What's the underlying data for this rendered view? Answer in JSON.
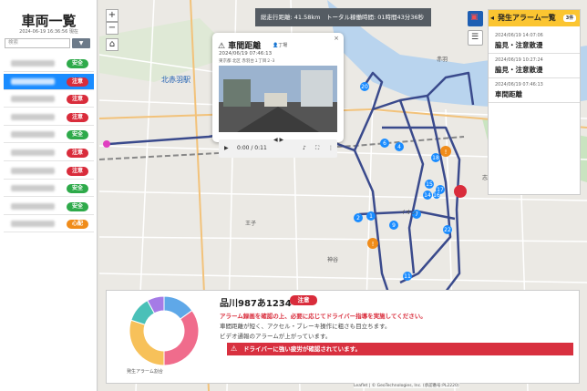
{
  "sidebar": {
    "title": "車両一覧",
    "updated": "2024-06-19 16:36:56 現在",
    "search_placeholder": "検索",
    "filter_icon": "filter-icon",
    "vehicles": [
      {
        "status": "安全",
        "color": "green",
        "selected": false
      },
      {
        "status": "注意",
        "color": "red",
        "selected": true
      },
      {
        "status": "注意",
        "color": "red",
        "selected": false
      },
      {
        "status": "注意",
        "color": "red",
        "selected": false
      },
      {
        "status": "安全",
        "color": "green",
        "selected": false
      },
      {
        "status": "注意",
        "color": "red",
        "selected": false
      },
      {
        "status": "注意",
        "color": "red",
        "selected": false
      },
      {
        "status": "安全",
        "color": "green",
        "selected": false
      },
      {
        "status": "安全",
        "color": "green",
        "selected": false
      },
      {
        "status": "心配",
        "color": "orange",
        "selected": false
      }
    ]
  },
  "map": {
    "zoom_in": "+",
    "zoom_out": "−",
    "labels": [
      "北赤羽駅",
      "志茂",
      "赤羽",
      "神谷",
      "王子",
      "イオン"
    ],
    "stats": "総走行距離: 41.58km　トータル稼働時間: 01時間43分36秒",
    "attribution": "Leaflet | © GeoTechnologies, Inc. (承認番号:PL2220)"
  },
  "popup": {
    "title": "車間距離",
    "driver": "丁場",
    "close": "×",
    "time": "2024/06/19 07:46:13",
    "address": "東京都 北区 赤羽台１丁目２-3",
    "video_time": "0:00 / 0:11"
  },
  "alarms": {
    "title": "発生アラーム一覧",
    "count": "3件",
    "items": [
      {
        "time": "2024/06/19 14:07:06",
        "label": "脇見・注意散漫"
      },
      {
        "time": "2024/06/19 10:27:24",
        "label": "脇見・注意散漫"
      },
      {
        "time": "2024/06/19 07:46:13",
        "label": "車間距離"
      }
    ]
  },
  "detail": {
    "plate": "品川987あ1234",
    "status": "注意",
    "message": "アラーム録画を確認の上、必要に応じてドライバー指導を実施してください。",
    "line1": "車間距離が短く、アクセル・ブレーキ操作に粗さも目立ちます。",
    "line2": "ビデオ通報のアラームが上がっています。",
    "warning": "ドライバーに強い疲労が確認されています。",
    "donut_label": "発生アラーム割合",
    "donut_colors": [
      "#5fa8e8",
      "#f06c8c",
      "#f7c15a",
      "#4ac0b8",
      "#a57be6"
    ],
    "donut_values": [
      0.15,
      0.35,
      0.3,
      0.12,
      0.08
    ]
  },
  "colors": {
    "accent": "#1a8cff",
    "danger": "#d92c3b",
    "safe": "#2eaa4a",
    "warn": "#f08c1a",
    "alarm_header": "#fbc531"
  }
}
